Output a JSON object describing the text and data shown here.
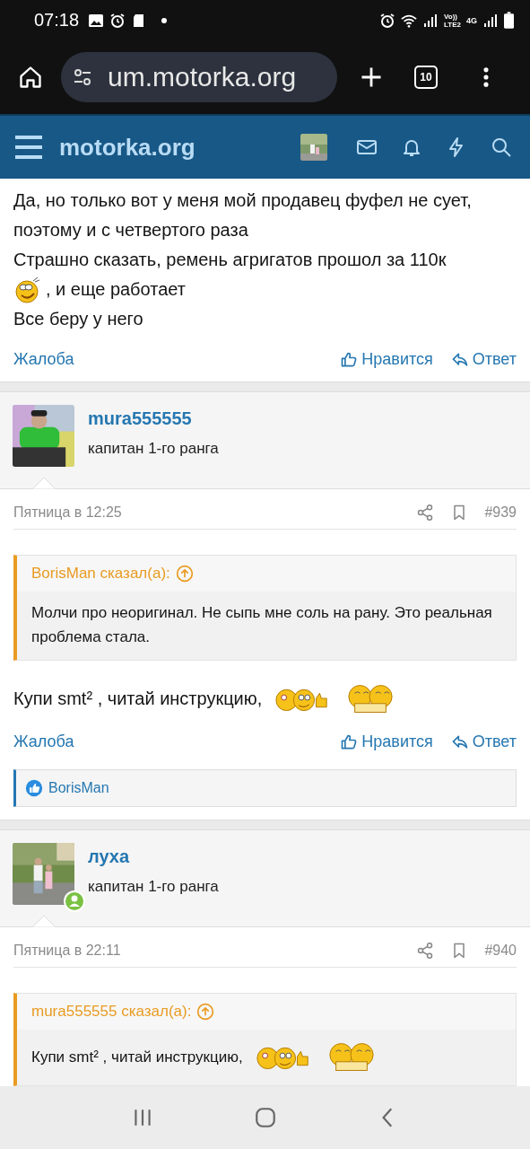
{
  "status_bar": {
    "time": "07:18",
    "volte": "Vo))",
    "lte": "LTE2",
    "network": "4G"
  },
  "browser": {
    "url": "um.motorka.org",
    "tab_count": "10"
  },
  "site_header": {
    "title": "motorka.org"
  },
  "posts": [
    {
      "body": [
        [
          {
            "kind": "text",
            "text": "Да, но только вот у меня мой продавец фуфел не сует, поэтому и с четвертого раза"
          }
        ],
        [
          {
            "kind": "text",
            "text": "Страшно сказать, ремень агригатов прошол за 110к"
          }
        ],
        [
          {
            "kind": "grin"
          },
          {
            "kind": "text",
            "text": ", и еще работает"
          }
        ],
        [
          {
            "kind": "text",
            "text": "Все беру у него"
          }
        ]
      ],
      "actions": {
        "report": "Жалоба",
        "like": "Нравится",
        "reply": "Ответ"
      }
    },
    {
      "user": {
        "name": "mura555555",
        "rank": "капитан 1-го ранга",
        "online": false
      },
      "date": "Пятница в 12:25",
      "number": "#939",
      "quote": {
        "author": "BorisMan сказал(а):",
        "text": "Молчи про неоригинал. Не сыпь мне соль на рану. Это реальная проблема стала."
      },
      "body": [
        [
          {
            "kind": "text",
            "text": "Купи smt² , читай инструкцию,"
          },
          {
            "kind": "thumbs"
          },
          {
            "kind": "cheers"
          }
        ]
      ],
      "actions": {
        "report": "Жалоба",
        "like": "Нравится",
        "reply": "Ответ"
      },
      "reactions": "BorisMan"
    },
    {
      "user": {
        "name": "луха",
        "rank": "капитан 1-го ранга",
        "online": true
      },
      "date": "Пятница в 22:11",
      "number": "#940",
      "quote": {
        "author": "mura555555 сказал(а):",
        "body": [
          {
            "kind": "text",
            "text": "Купи smt² , читай инструкцию,"
          },
          {
            "kind": "thumbs"
          },
          {
            "kind": "cheers"
          }
        ]
      }
    }
  ]
}
